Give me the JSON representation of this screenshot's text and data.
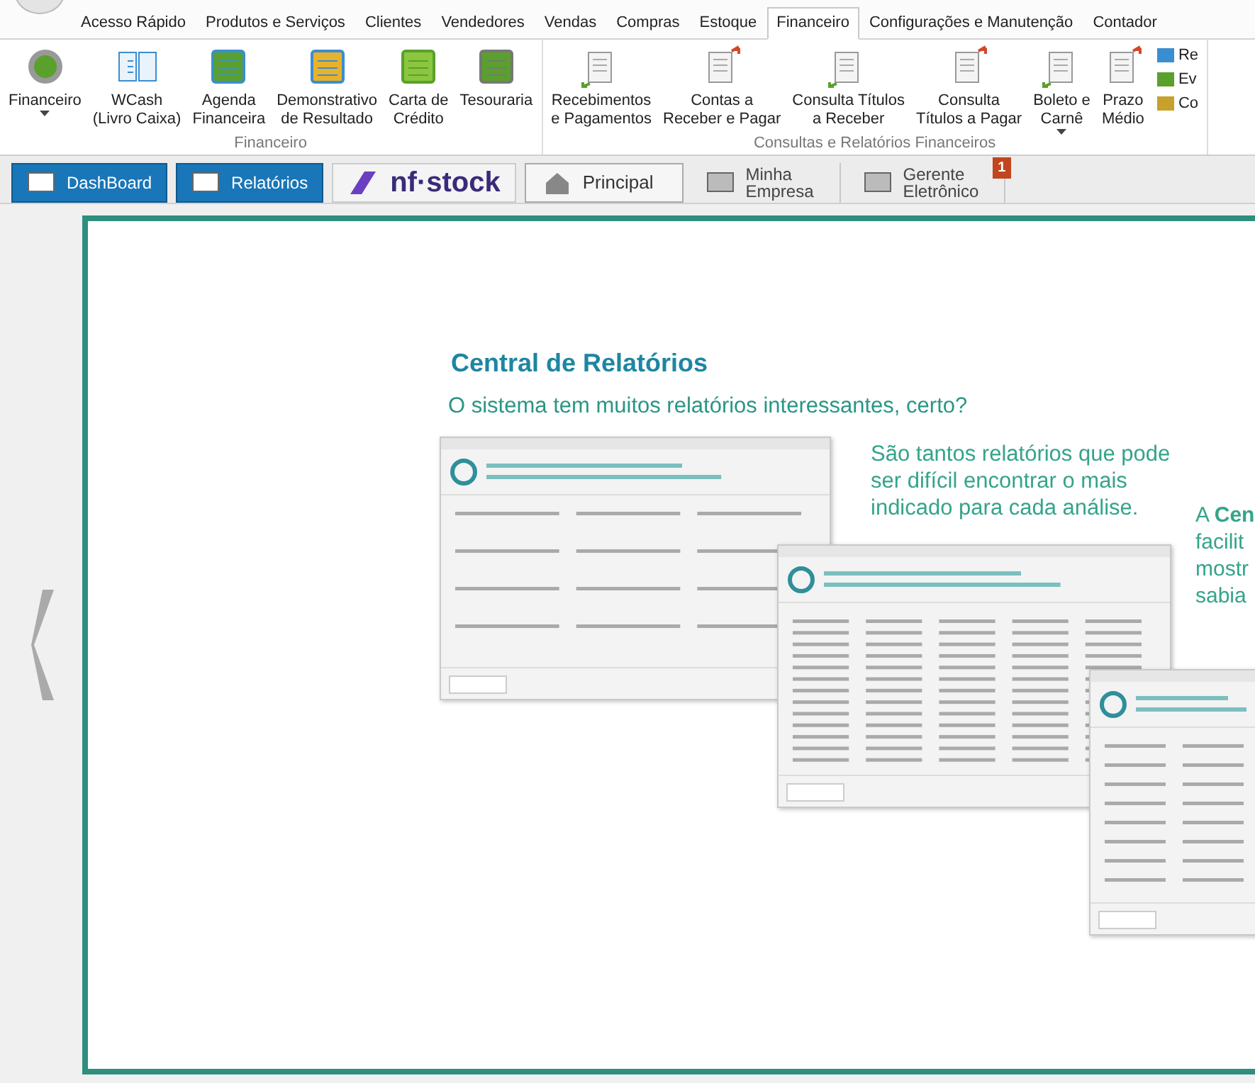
{
  "menu_tabs": [
    {
      "label": "Acesso Rápido",
      "selected": false
    },
    {
      "label": "Produtos e Serviços",
      "selected": false
    },
    {
      "label": "Clientes",
      "selected": false
    },
    {
      "label": "Vendedores",
      "selected": false
    },
    {
      "label": "Vendas",
      "selected": false
    },
    {
      "label": "Compras",
      "selected": false
    },
    {
      "label": "Estoque",
      "selected": false
    },
    {
      "label": "Financeiro",
      "selected": true
    },
    {
      "label": "Configurações e Manutenção",
      "selected": false
    },
    {
      "label": "Contador",
      "selected": false
    }
  ],
  "ribbon": {
    "groups": [
      {
        "label": "Financeiro",
        "buttons": [
          {
            "label": "Financeiro",
            "dropdown": true
          },
          {
            "label": "WCash\n(Livro Caixa)",
            "dropdown": false
          },
          {
            "label": "Agenda\nFinanceira",
            "dropdown": false
          },
          {
            "label": "Demonstrativo\nde Resultado",
            "dropdown": false
          },
          {
            "label": "Carta de\nCrédito",
            "dropdown": false
          },
          {
            "label": "Tesouraria",
            "dropdown": false
          }
        ]
      },
      {
        "label": "Consultas e Relatórios Financeiros",
        "buttons": [
          {
            "label": "Recebimentos\ne Pagamentos",
            "dropdown": false
          },
          {
            "label": "Contas a\nReceber e Pagar",
            "dropdown": false
          },
          {
            "label": "Consulta Títulos\na Receber",
            "dropdown": false
          },
          {
            "label": "Consulta\nTítulos a Pagar",
            "dropdown": false
          },
          {
            "label": "Boleto e\nCarnê",
            "dropdown": true
          },
          {
            "label": "Prazo\nMédio",
            "dropdown": false
          }
        ],
        "small_buttons": [
          "Re",
          "Ev",
          "Co"
        ]
      }
    ]
  },
  "modules": [
    {
      "label": "DashBoard",
      "kind": "blue"
    },
    {
      "label": "Relatórios",
      "kind": "blue"
    },
    {
      "label": "nf·stock",
      "kind": "logo"
    },
    {
      "label": "Principal",
      "kind": "framed"
    },
    {
      "label": "Minha\nEmpresa",
      "kind": "plain"
    },
    {
      "label": "Gerente\nEletrônico",
      "kind": "plain",
      "badge": "1"
    }
  ],
  "slide": {
    "title": "Central de Relatórios",
    "subtitle": "O sistema tem muitos relatórios interessantes, certo?",
    "paragraph": "São tantos relatórios que pode\nser difícil encontrar o mais\nindicado para cada análise.",
    "side_text": "A **Cen**\nfacilit\nmostr\nsabia"
  }
}
